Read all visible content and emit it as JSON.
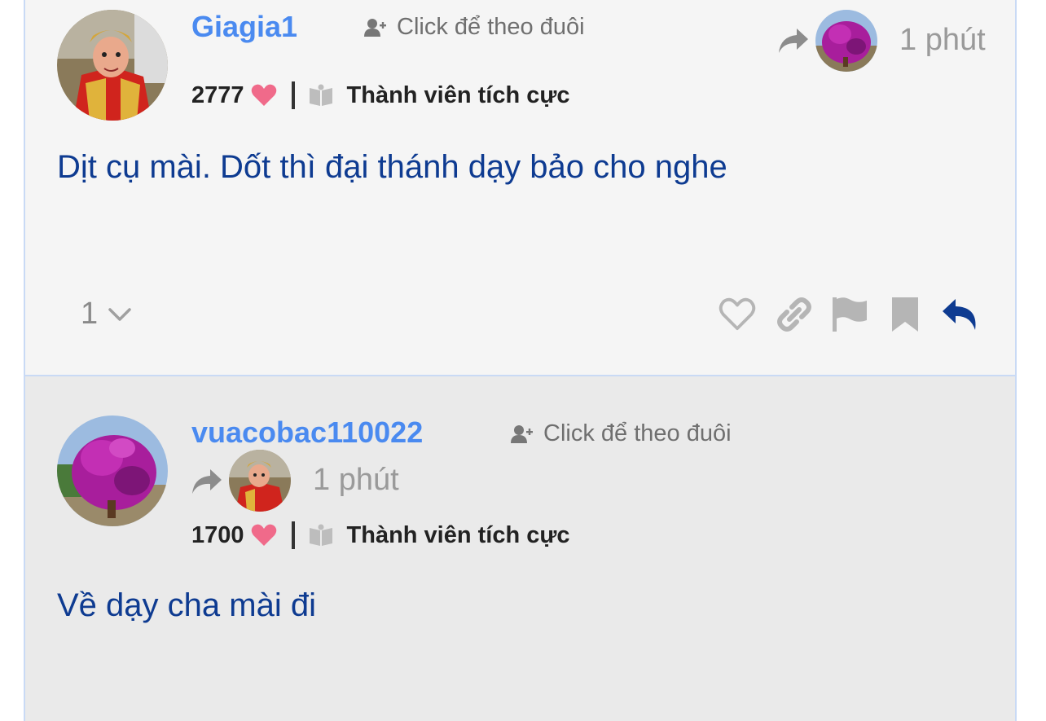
{
  "posts": [
    {
      "username": "Giagia1",
      "follow_label": "Click để theo đuôi",
      "time": "1 phút",
      "likes": "2777",
      "rank": "Thành viên tích cực",
      "content": "Dịt cụ mài. Dốt thì đại thánh dạy bảo cho nghe",
      "reply_count": "1"
    },
    {
      "username": "vuacobac110022",
      "follow_label": "Click để theo đuôi",
      "time": "1 phút",
      "likes": "1700",
      "rank": "Thành viên tích cực",
      "content": "Về dạy cha mài đi"
    }
  ],
  "colors": {
    "username": "#4a8af0",
    "content": "#0e3b91",
    "heart": "#f06a8a",
    "reply_action": "#0e3b91",
    "muted_icon": "#b5b5b5"
  },
  "icons": [
    "user-plus-icon",
    "share-arrow-icon",
    "heart-icon",
    "book-icon",
    "chevron-down-icon",
    "like-outline-icon",
    "link-icon",
    "flag-icon",
    "bookmark-icon",
    "reply-icon"
  ]
}
